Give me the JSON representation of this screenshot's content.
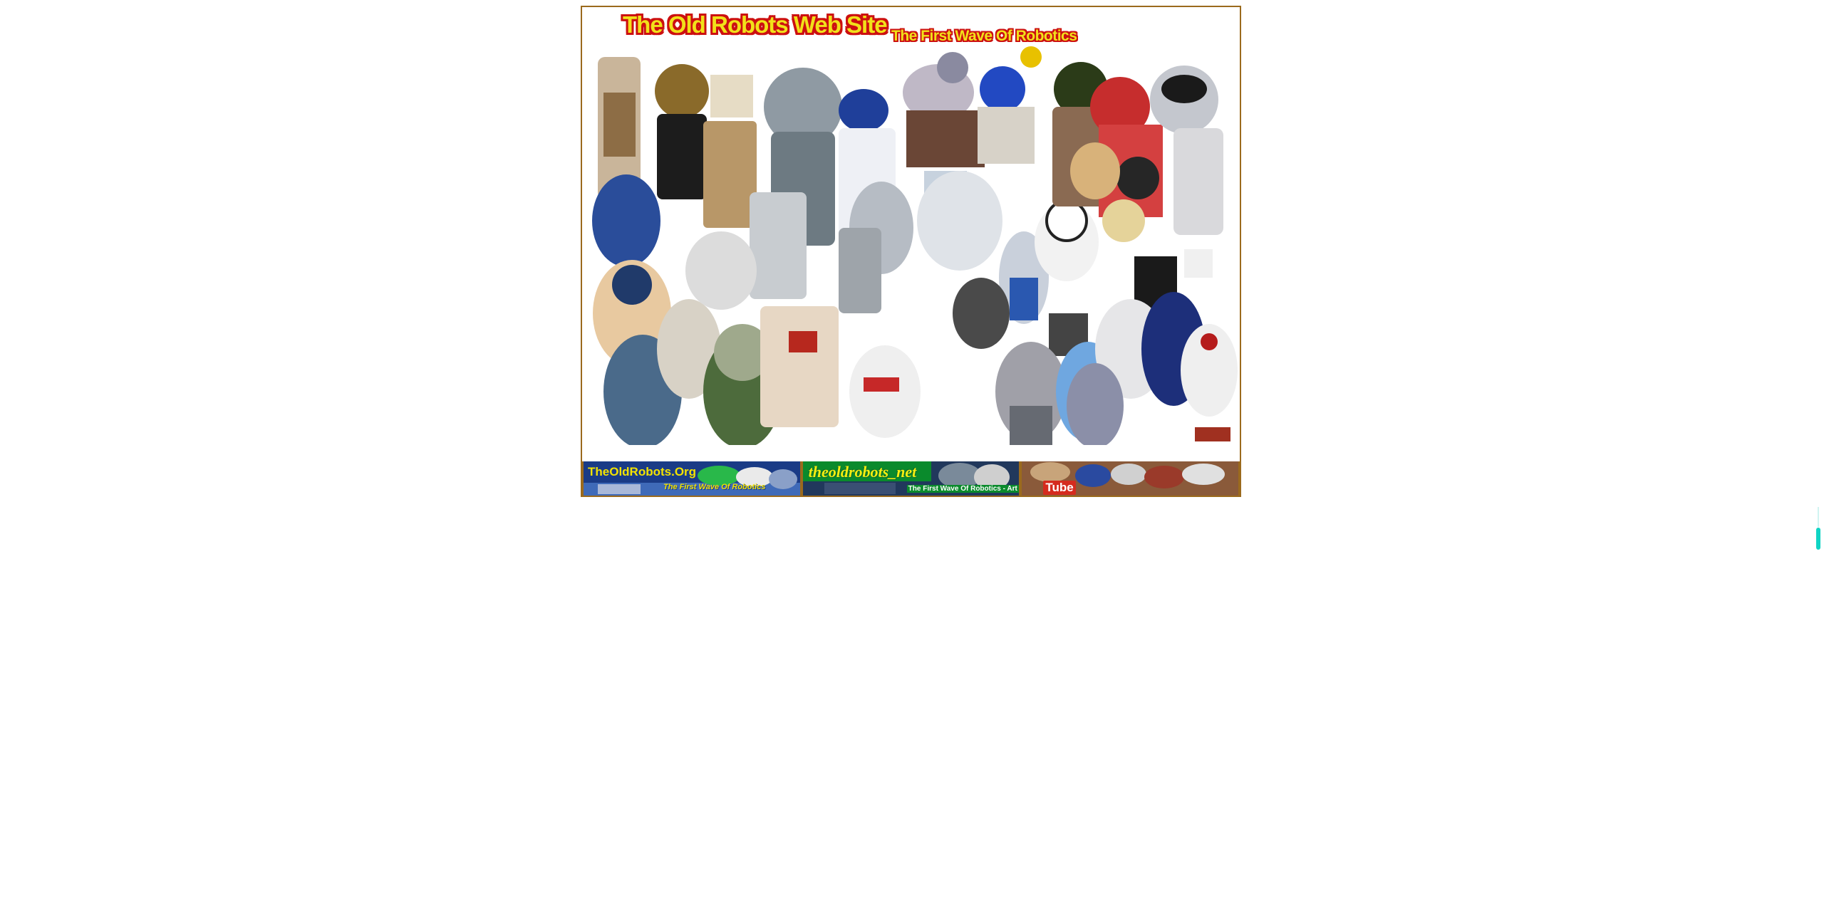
{
  "site": {
    "title": "The Old Robots Web Site",
    "subtitle": "The First Wave Of Robotics"
  },
  "banners": [
    {
      "main": "TheOldRobots.Org",
      "sub": "The First Wave Of Robotics"
    },
    {
      "main": "theoldrobots_net",
      "sub": "The First Wave Of Robotics - Art"
    },
    {
      "main": "Tube"
    }
  ],
  "colors": {
    "frame": "#9b6a1d",
    "title_fill": "#f1e11a",
    "title_outline": "#cc1010",
    "accent_scroll": "#10d4c4"
  },
  "icons": {
    "scroll": "scroll-indicator-icon"
  }
}
